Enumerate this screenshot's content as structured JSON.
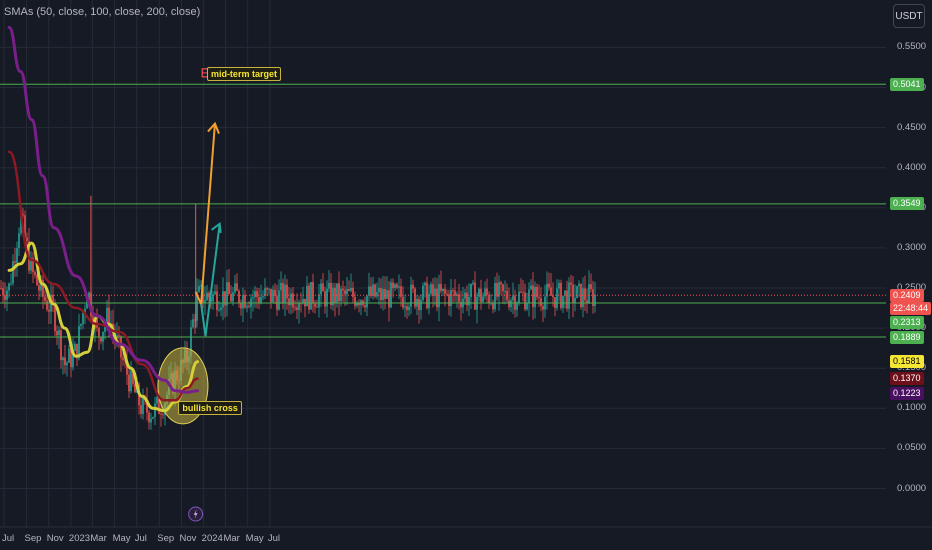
{
  "indicator_label": "SMAs (50, close, 100, close, 200, close)",
  "currency": "USDT",
  "colors": {
    "background": "#161a25",
    "grid": "#252a36",
    "candle_up": "#26a69a",
    "candle_down": "#ef5350",
    "sma50": "#d4cf3a",
    "sma100": "#8b1a24",
    "sma200": "#7a1f8a",
    "level_line": "#4caf50",
    "arrow_orange": "#f0a030",
    "arrow_teal": "#26a69a",
    "circle_fill": "#c6b33e"
  },
  "chart_data": {
    "type": "line",
    "title": "",
    "x_ticks": [
      "Jul",
      "Sep",
      "Nov",
      "2023",
      "Mar",
      "May",
      "Jul",
      "Sep",
      "Nov",
      "2024",
      "Mar",
      "May",
      "Jul"
    ],
    "y_ticks": [
      "0.5500",
      "0.5000",
      "0.4500",
      "0.4000",
      "0.3500",
      "0.3000",
      "0.2500",
      "0.2000",
      "0.1500",
      "0.1000",
      "0.0500",
      "0.0000"
    ],
    "ylim": [
      0.0,
      0.55
    ],
    "series": [
      {
        "name": "SMA 50",
        "tag": "0.1581",
        "x": [
          "2022-07",
          "2022-08",
          "2022-09",
          "2022-10",
          "2022-11",
          "2022-12",
          "2023-01",
          "2023-02",
          "2023-03",
          "2023-04",
          "2023-05",
          "2023-06",
          "2023-07",
          "2023-08",
          "2023-09",
          "2023-10",
          "2023-11",
          "2023-12"
        ],
        "values": [
          0.272,
          0.28,
          0.306,
          0.255,
          0.23,
          0.2,
          0.165,
          0.17,
          0.215,
          0.205,
          0.18,
          0.15,
          0.115,
          0.1,
          0.097,
          0.108,
          0.127,
          0.158
        ]
      },
      {
        "name": "SMA 100",
        "tag": "0.1370",
        "x": [
          "2022-07",
          "2022-09",
          "2022-11",
          "2023-01",
          "2023-03",
          "2023-05",
          "2023-07",
          "2023-09",
          "2023-10",
          "2023-11",
          "2023-12"
        ],
        "values": [
          0.42,
          0.285,
          0.255,
          0.225,
          0.205,
          0.195,
          0.155,
          0.11,
          0.11,
          0.125,
          0.137
        ]
      },
      {
        "name": "SMA 200",
        "tag": "0.1223",
        "x": [
          "2022-07",
          "2022-08",
          "2022-09",
          "2022-10",
          "2022-11",
          "2023-01",
          "2023-03",
          "2023-05",
          "2023-07",
          "2023-09",
          "2023-10",
          "2023-11",
          "2023-12"
        ],
        "values": [
          0.575,
          0.52,
          0.46,
          0.39,
          0.325,
          0.265,
          0.215,
          0.18,
          0.16,
          0.135,
          0.122,
          0.12,
          0.122
        ]
      }
    ],
    "price_path": {
      "x": [
        "2022-07",
        "2022-08",
        "2022-09",
        "2022-10",
        "2022-11",
        "2022-12",
        "2023-01",
        "2023-02",
        "2023-03",
        "2023-04",
        "2023-05",
        "2023-06",
        "2023-07",
        "2023-08",
        "2023-09",
        "2023-10",
        "2023-11",
        "2023-12"
      ],
      "values": [
        0.25,
        0.34,
        0.27,
        0.24,
        0.22,
        0.155,
        0.17,
        0.25,
        0.19,
        0.215,
        0.17,
        0.13,
        0.1,
        0.095,
        0.11,
        0.14,
        0.16,
        0.24
      ]
    },
    "horizontal_levels": [
      0.5041,
      0.3549,
      0.2313,
      0.1889
    ],
    "price_tags": [
      {
        "label": "0.5041",
        "bg": "#4caf50",
        "fg": "#ffffff",
        "y_value": 0.5041
      },
      {
        "label": "0.3549",
        "bg": "#4caf50",
        "fg": "#ffffff",
        "y_value": 0.3549
      },
      {
        "label": "0.2409",
        "bg": "#ef5350",
        "fg": "#ffffff",
        "y_value": 0.2409
      },
      {
        "label": "22:48:44",
        "bg": "#ef5350",
        "fg": "#ffffff",
        "y_value": 0.225
      },
      {
        "label": "0.2313",
        "bg": "#4caf50",
        "fg": "#ffffff",
        "y_value": 0.207
      },
      {
        "label": "0.1889",
        "bg": "#4caf50",
        "fg": "#ffffff",
        "y_value": 0.1889
      },
      {
        "label": "0.1581",
        "bg": "#f5e634",
        "fg": "#000000",
        "y_value": 0.1581
      },
      {
        "label": "0.1370",
        "bg": "#6e0f1a",
        "fg": "#ffffff",
        "y_value": 0.137
      },
      {
        "label": "0.1223",
        "bg": "#4a1060",
        "fg": "#ffffff",
        "y_value": 0.118
      }
    ],
    "annotations": [
      {
        "text": "mid-term target",
        "date": "2024-01-10",
        "y_value": 0.517
      },
      {
        "text": "bullish cross",
        "date": "2023-12-01",
        "y_value": 0.1
      }
    ]
  }
}
